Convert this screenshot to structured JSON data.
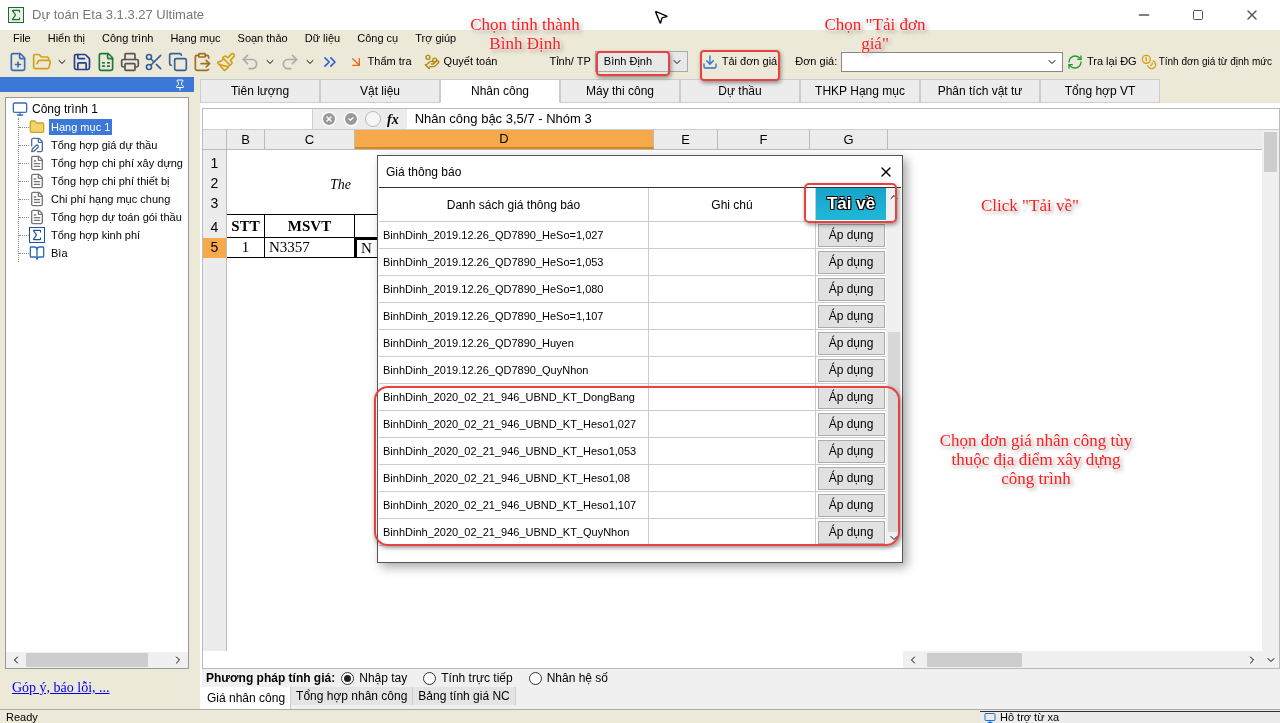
{
  "window": {
    "title": "Dự toán Eta 3.1.3.27 Ultimate"
  },
  "menu": [
    {
      "label": "File"
    },
    {
      "label": "Hiển thị"
    },
    {
      "label": "Công trình"
    },
    {
      "label": "Hạng mục"
    },
    {
      "label": "Soạn thảo"
    },
    {
      "label": "Dữ liệu"
    },
    {
      "label": "Công cụ"
    },
    {
      "label": "Trợ giúp"
    }
  ],
  "toolbar": {
    "check_button": "Thẩm tra",
    "settle_button": "Quyết toán",
    "province_label": "Tỉnh/ TP",
    "province_value": "Bình Định",
    "download_button": "Tải đơn giá",
    "price_label": "Đơn giá:",
    "reload_button": "Tra lại ĐG",
    "compute_button": "Tính đơn giá từ định mức"
  },
  "left_panel": {
    "tree": [
      {
        "label": "Công trình 1",
        "selected": false,
        "children": [
          {
            "label": "Hạng mục 1",
            "kind": "folder",
            "selected": true
          },
          {
            "label": "Tổng hợp giá dự thầu",
            "kind": "edit",
            "selected": false
          },
          {
            "label": "Tổng hợp chi phí xây dựng",
            "kind": "doc",
            "selected": false
          },
          {
            "label": "Tổng hợp chi phí thiết bị",
            "kind": "doc",
            "selected": false
          },
          {
            "label": "Chi phí hạng mục chung",
            "kind": "doc",
            "selected": false
          },
          {
            "label": "Tổng hợp dự toán gói thầu",
            "kind": "doc",
            "selected": false
          },
          {
            "label": "Tổng hợp kinh phí",
            "kind": "sum",
            "selected": false
          },
          {
            "label": "Bìa",
            "kind": "cover",
            "selected": false
          }
        ]
      }
    ],
    "link": "Góp ý, báo lỗi, ..."
  },
  "tabs": [
    {
      "label": "Tiên lượng",
      "selected": false
    },
    {
      "label": "Vật liệu",
      "selected": false
    },
    {
      "label": "Nhân công",
      "selected": true
    },
    {
      "label": "Máy thi công",
      "selected": false
    },
    {
      "label": "Dự thầu",
      "selected": false
    },
    {
      "label": "THKP Hạng mục",
      "selected": false
    },
    {
      "label": "Phân tích vật tư",
      "selected": false
    },
    {
      "label": "Tổng hợp VT",
      "selected": false
    }
  ],
  "formula_bar": {
    "fx": "fx",
    "content": "Nhân công bậc 3,5/7 - Nhóm 3"
  },
  "sheet": {
    "columns": [
      {
        "label": "B",
        "selected": false
      },
      {
        "label": "C",
        "selected": false
      },
      {
        "label": "D",
        "selected": true
      },
      {
        "label": "E",
        "selected": false
      },
      {
        "label": "F",
        "selected": false
      },
      {
        "label": "G",
        "selected": false
      }
    ],
    "rows": [
      {
        "label": "1",
        "kind": "title",
        "selected": false
      },
      {
        "label": "2",
        "kind": "title",
        "selected": false,
        "c": "The"
      },
      {
        "label": "3",
        "kind": "title",
        "selected": false
      },
      {
        "label": "4",
        "kind": "header",
        "selected": false,
        "b": "STT",
        "c": "MSVT"
      },
      {
        "label": "5",
        "kind": "data",
        "selected": true,
        "b": "1",
        "c": "N3357",
        "d": "N"
      }
    ]
  },
  "method": {
    "label": "Phương pháp tính giá:",
    "options": [
      {
        "label": "Nhập tay",
        "selected": true
      },
      {
        "label": "Tính trực tiếp",
        "selected": false
      },
      {
        "label": "Nhân hệ số",
        "selected": false
      }
    ]
  },
  "sheet_tabs": [
    {
      "label": "Giá nhân công",
      "selected": true
    },
    {
      "label": "Tổng hợp nhân công",
      "selected": false
    },
    {
      "label": "Bảng tính giá NC",
      "selected": false
    }
  ],
  "status_bar": {
    "text": "Ready",
    "remote": "Hỗ trợ từ xa"
  },
  "dialog": {
    "title": "Giá thông báo",
    "columns": [
      "Danh sách giá thông báo",
      "Ghi chú"
    ],
    "download_button": "Tải về",
    "rows": [
      {
        "name": "BinhDinh_2019.12.26_QD7890_HeSo=1,027",
        "action": "Áp dụng"
      },
      {
        "name": "BinhDinh_2019.12.26_QD7890_HeSo=1,053",
        "action": "Áp dụng"
      },
      {
        "name": "BinhDinh_2019.12.26_QD7890_HeSo=1,080",
        "action": "Áp dụng"
      },
      {
        "name": "BinhDinh_2019.12.26_QD7890_HeSo=1,107",
        "action": "Áp dụng"
      },
      {
        "name": "BinhDinh_2019.12.26_QD7890_Huyen",
        "action": "Áp dụng"
      },
      {
        "name": "BinhDinh_2019.12.26_QD7890_QuyNhon",
        "action": "Áp dụng"
      },
      {
        "name": "BinhDinh_2020_02_21_946_UBND_KT_DongBang",
        "action": "Áp dụng"
      },
      {
        "name": "BinhDinh_2020_02_21_946_UBND_KT_Heso1,027",
        "action": "Áp dụng"
      },
      {
        "name": "BinhDinh_2020_02_21_946_UBND_KT_Heso1,053",
        "action": "Áp dụng"
      },
      {
        "name": "BinhDinh_2020_02_21_946_UBND_KT_Heso1,08",
        "action": "Áp dụng"
      },
      {
        "name": "BinhDinh_2020_02_21_946_UBND_KT_Heso1,107",
        "action": "Áp dụng"
      },
      {
        "name": "BinhDinh_2020_02_21_946_UBND_KT_QuyNhon",
        "action": "Áp dụng"
      }
    ]
  },
  "annotations": [
    {
      "text": "Chọn tỉnh thành Bình Định"
    },
    {
      "text": "Chọn \"Tải đơn giá\""
    },
    {
      "text": "Click \"Tải về\""
    },
    {
      "text": "Chọn đơn giá nhân công tùy thuộc địa điểm xây dựng công trình"
    }
  ]
}
